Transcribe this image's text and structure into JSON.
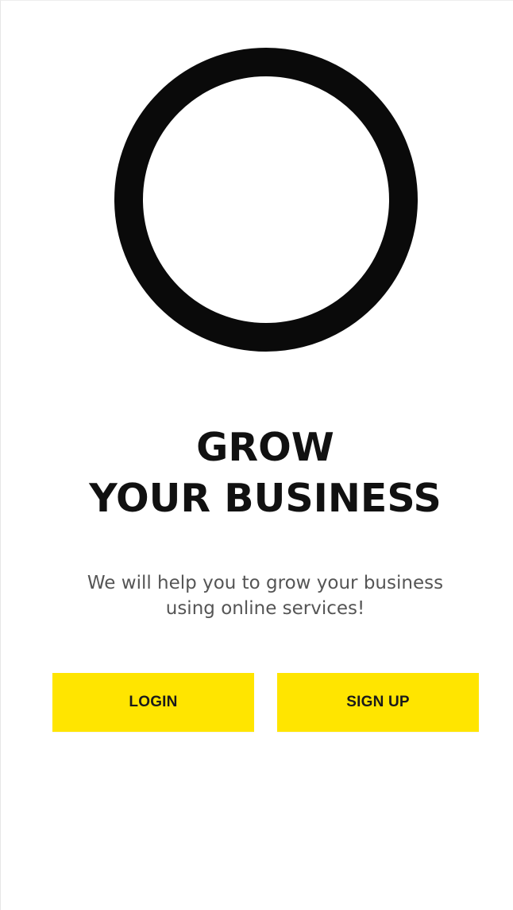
{
  "logo": {
    "icon": "ring-logo-icon",
    "color": "#0a0a0a"
  },
  "headline": {
    "line1": "GROW",
    "line2": "YOUR BUSINESS"
  },
  "subtitle": {
    "line1": "We will help you to grow your business",
    "line2": "using online services!"
  },
  "buttons": {
    "login_label": "LOGIN",
    "signup_label": "SIGN UP",
    "color": "#FFE500"
  }
}
